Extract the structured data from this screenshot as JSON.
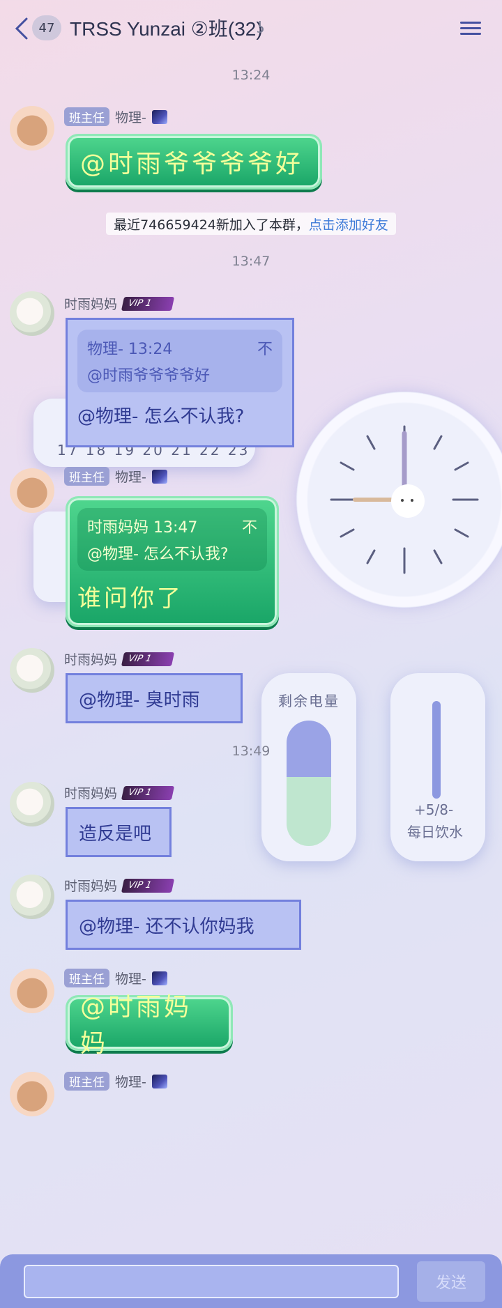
{
  "header": {
    "unread": "47",
    "title": "TRSS Yunzai ②班(32)"
  },
  "messages": {
    "t1": "13:24",
    "m1": {
      "role": "班主任",
      "name": "物理-",
      "text": "@时雨爷爷爷爷好"
    },
    "notice": {
      "text": "最近746659424新加入了本群，",
      "link": "点击添加好友"
    },
    "t2": "13:47",
    "m2": {
      "name": "时雨妈妈",
      "vip": "VIP 1",
      "quote_head": "物理- 13:24",
      "quote_icon": "不",
      "quote_body": "@时雨爷爷爷爷好",
      "text": "@物理- 怎么不认我?"
    },
    "m3": {
      "role": "班主任",
      "name": "物理-",
      "quote_head": "时雨妈妈 13:47",
      "quote_icon": "不",
      "quote_body": "@物理- 怎么不认我?",
      "text": "谁问你了"
    },
    "m4": {
      "name": "时雨妈妈",
      "vip": "VIP 1",
      "text": "@物理- 臭时雨"
    },
    "t3": "13:49",
    "m5": {
      "name": "时雨妈妈",
      "vip": "VIP 1",
      "text": "造反是吧"
    },
    "m6": {
      "name": "时雨妈妈",
      "vip": "VIP 1",
      "text": "@物理- 还不认你妈我"
    },
    "m7": {
      "role": "班主任",
      "name": "物理-",
      "text": "@时雨妈妈"
    },
    "m8": {
      "role": "班主任",
      "name": "物理-"
    }
  },
  "widgets": {
    "battery": "剩余电量",
    "water_count": "+5/8-",
    "water_label": "每日饮水",
    "calendar": "17 18 19 20 21 22 23"
  },
  "composer": {
    "send": "发送",
    "input_value": ""
  },
  "colors": {
    "green": "#19a567",
    "blue_bubble": "#b9c2f3",
    "accent": "#8c98e0"
  }
}
